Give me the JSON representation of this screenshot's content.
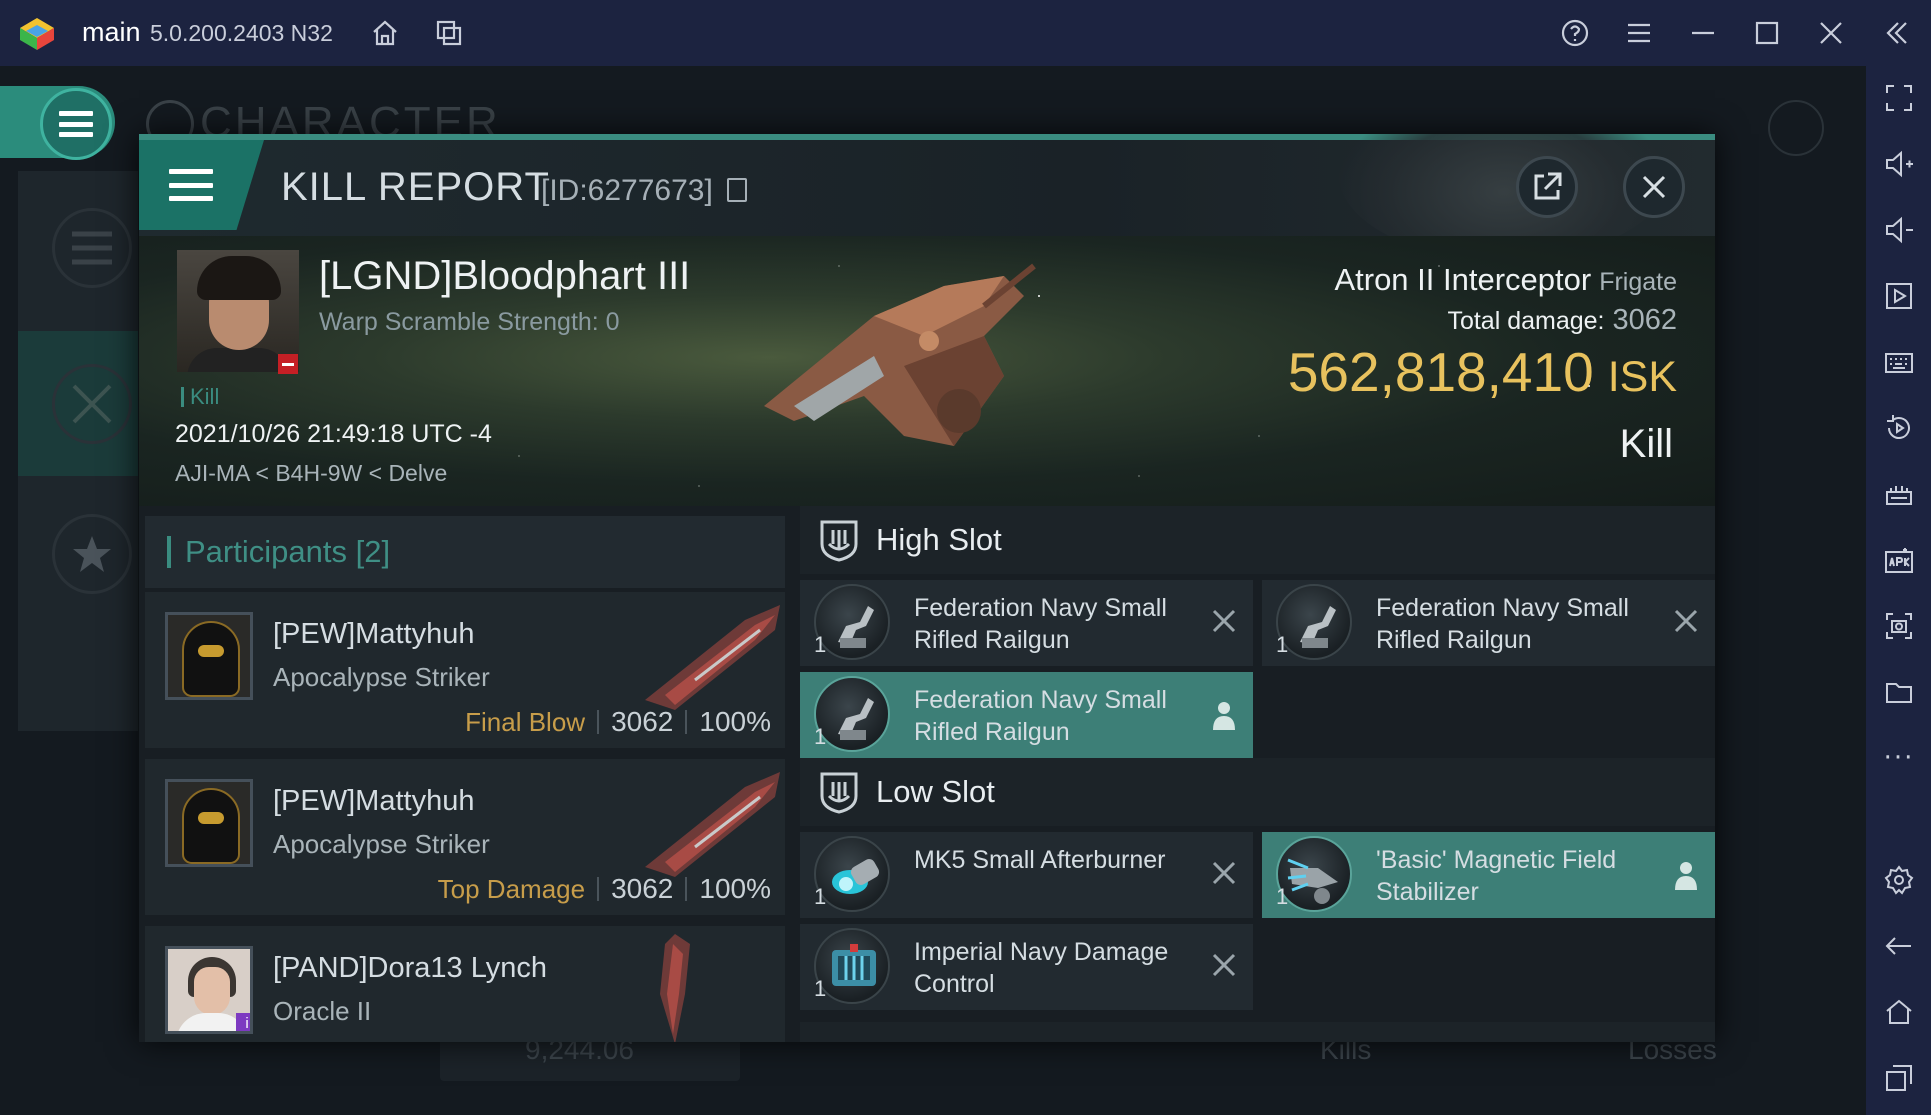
{
  "emulator": {
    "app_name": "main",
    "version": "5.0.200.2403  N32",
    "colors": {
      "chrome": "#1c2340",
      "icon": "#c9cedb"
    },
    "title_icons": [
      "home-icon",
      "multi-instance-icon",
      "help-icon",
      "menu-icon",
      "minimize-icon",
      "maximize-icon",
      "close-icon",
      "collapse-sidebar-icon"
    ],
    "sidebar_icons": [
      "fullscreen-icon",
      "volume-up-icon",
      "volume-down-icon",
      "play-icon",
      "keyboard-icon",
      "rotate-icon",
      "macro-icon",
      "apk-icon",
      "screenshot-icon",
      "folder-icon",
      "more-icon",
      "settings-icon",
      "back-icon",
      "home-icon",
      "recent-apps-icon"
    ],
    "more_label": "···"
  },
  "background": {
    "character_title": "CHARACTER",
    "balance": "9,244.06",
    "kills_label": "Kills",
    "losses_label": "Losses"
  },
  "kill_report": {
    "title": "KILL REPORT",
    "id": "[ID:6277673]",
    "victim": {
      "name": "[LGND]Bloodphart III",
      "warp_scramble": "Warp Scramble Strength: 0",
      "kill_tag": "Kill",
      "datetime": "2021/10/26 21:49:18 UTC -4",
      "location": "AJI-MA < B4H-9W < Delve"
    },
    "ship": {
      "name": "Atron II Interceptor",
      "class": "Frigate",
      "total_damage_label": "Total damage:",
      "total_damage": "3062",
      "isk_value": "562,818,410",
      "isk_unit": "ISK",
      "result": "Kill"
    },
    "colors": {
      "accent": "#3a8c80",
      "isk": "#e8c25e",
      "highlight": "#3d7f77",
      "stat_label": "#c79d4a"
    }
  },
  "participants": {
    "title": "Participants",
    "count": "[2]",
    "rows": [
      {
        "name": "[PEW]Mattyhuh",
        "ship": "Apocalypse Striker",
        "label": "Final Blow",
        "damage": "3062",
        "percent": "100%"
      },
      {
        "name": "[PEW]Mattyhuh",
        "ship": "Apocalypse Striker",
        "label": "Top Damage",
        "damage": "3062",
        "percent": "100%"
      },
      {
        "name": "[PAND]Dora13 Lynch",
        "ship": "Oracle II",
        "label": "",
        "damage": "",
        "percent": ""
      }
    ]
  },
  "fitting": {
    "high_slot_title": "High Slot",
    "low_slot_title": "Low Slot",
    "high_slots": [
      {
        "name": "Federation Navy Small Rifled Railgun",
        "qty": "1",
        "state": "destroyed"
      },
      {
        "name": "Federation Navy Small Rifled Railgun",
        "qty": "1",
        "state": "destroyed"
      },
      {
        "name": "Federation Navy Small Rifled Railgun",
        "qty": "1",
        "state": "dropped"
      }
    ],
    "low_slots": [
      {
        "name": "MK5 Small Afterburner",
        "qty": "1",
        "state": "destroyed"
      },
      {
        "name": "'Basic' Magnetic Field Stabilizer",
        "qty": "1",
        "state": "dropped"
      },
      {
        "name": "Imperial Navy Damage Control",
        "qty": "1",
        "state": "destroyed"
      }
    ]
  }
}
